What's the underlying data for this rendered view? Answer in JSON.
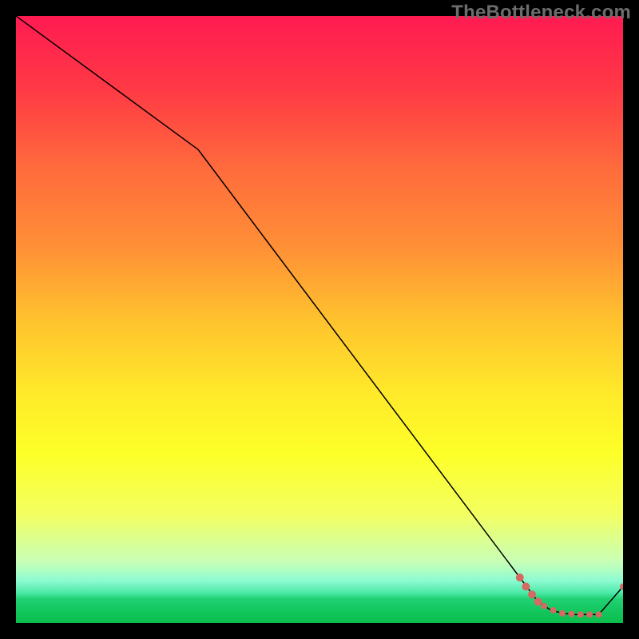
{
  "watermark": "TheBottleneck.com",
  "chart_data": {
    "type": "line",
    "title": "",
    "xlabel": "",
    "ylabel": "",
    "xlim": [
      0,
      100
    ],
    "ylim": [
      0,
      100
    ],
    "series": [
      {
        "name": "curve",
        "x": [
          0,
          30,
          83,
          86,
          88,
          90,
          92,
          94,
          96,
          100
        ],
        "y": [
          100,
          78,
          7.5,
          3.5,
          2.2,
          1.6,
          1.4,
          1.4,
          1.4,
          6
        ],
        "stroke": "#000000",
        "stroke_width": 1.5
      }
    ],
    "markers": [
      {
        "x": 83.0,
        "y": 7.5,
        "r": 5
      },
      {
        "x": 84.0,
        "y": 6.0,
        "r": 5
      },
      {
        "x": 85.0,
        "y": 4.7,
        "r": 5
      },
      {
        "x": 86.0,
        "y": 3.5,
        "r": 5
      },
      {
        "x": 87.0,
        "y": 2.8,
        "r": 4
      },
      {
        "x": 88.5,
        "y": 2.1,
        "r": 4
      },
      {
        "x": 90.0,
        "y": 1.6,
        "r": 4
      },
      {
        "x": 91.5,
        "y": 1.5,
        "r": 4
      },
      {
        "x": 93.0,
        "y": 1.4,
        "r": 4
      },
      {
        "x": 94.5,
        "y": 1.4,
        "r": 4
      },
      {
        "x": 96.0,
        "y": 1.4,
        "r": 4
      },
      {
        "x": 100.0,
        "y": 6.0,
        "r": 4
      }
    ],
    "marker_color": "#d46a62",
    "gradient_stops": [
      {
        "offset": 0,
        "color": "#ff1b52"
      },
      {
        "offset": 12,
        "color": "#ff3945"
      },
      {
        "offset": 25,
        "color": "#ff6b3c"
      },
      {
        "offset": 38,
        "color": "#ff8f36"
      },
      {
        "offset": 50,
        "color": "#ffc22e"
      },
      {
        "offset": 62,
        "color": "#ffe92a"
      },
      {
        "offset": 72,
        "color": "#fdff28"
      },
      {
        "offset": 82,
        "color": "#f3ff60"
      },
      {
        "offset": 90,
        "color": "#c7ffb8"
      },
      {
        "offset": 93,
        "color": "#8efbd1"
      },
      {
        "offset": 95,
        "color": "#4de9a8"
      },
      {
        "offset": 96,
        "color": "#23d175"
      },
      {
        "offset": 98,
        "color": "#12c75e"
      },
      {
        "offset": 100,
        "color": "#0bbd4b"
      }
    ]
  }
}
